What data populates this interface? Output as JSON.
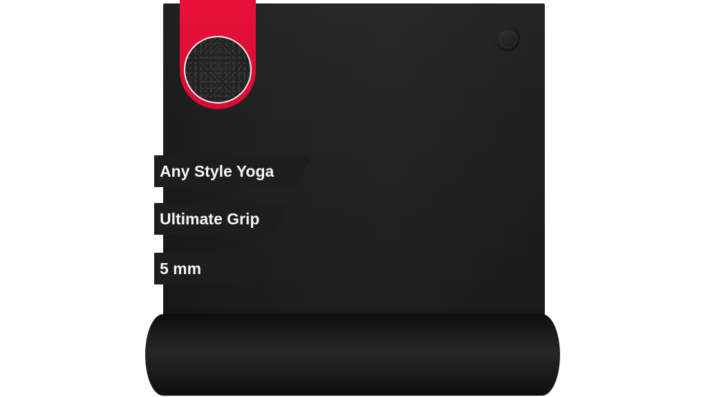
{
  "product": {
    "features": [
      {
        "label": "Any Style Yoga"
      },
      {
        "label": "Ultimate Grip"
      },
      {
        "label": "5 mm"
      }
    ],
    "colors": {
      "mat": "#222223",
      "ribbon": "#e8103a",
      "background": "#ffffff",
      "tag_text": "#f5f5f5"
    },
    "icons": [
      "texture-swatch-icon",
      "brand-logo-emboss-icon"
    ]
  }
}
